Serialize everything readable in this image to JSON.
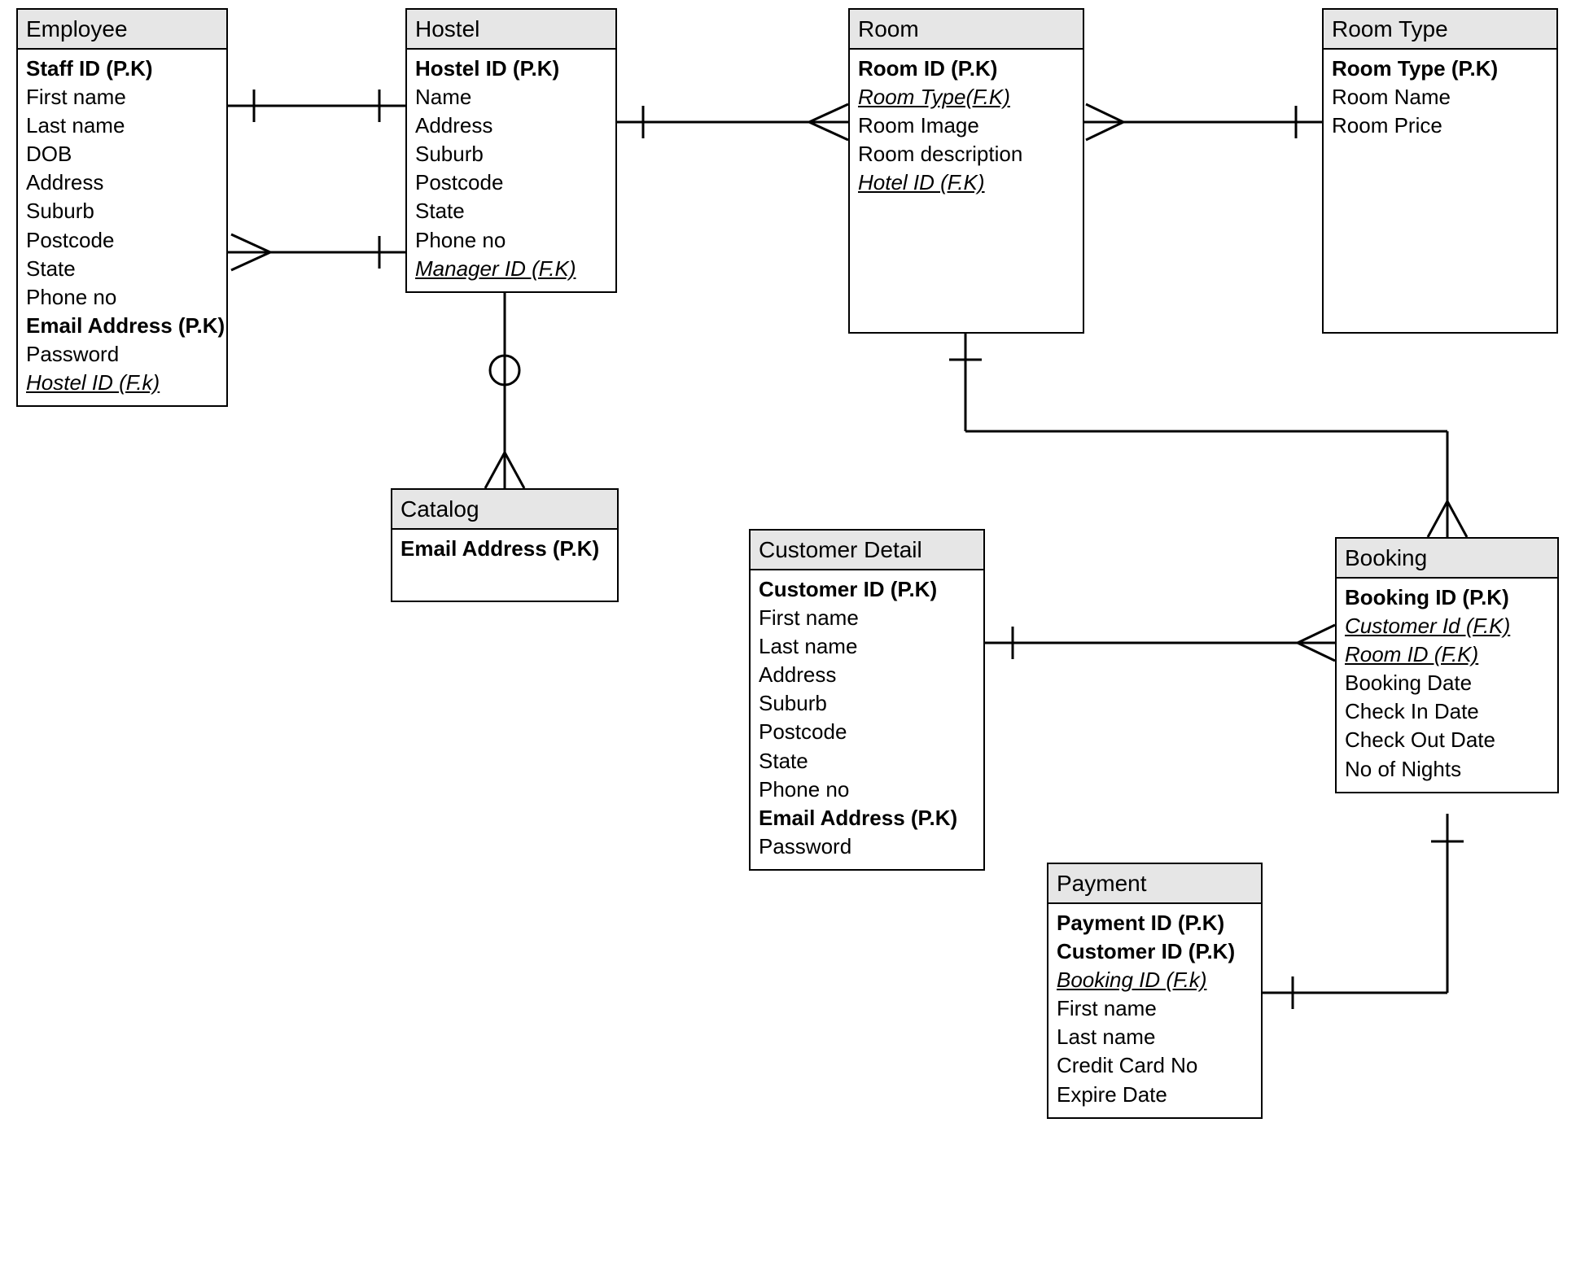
{
  "entities": {
    "employee": {
      "title": "Employee",
      "attrs": [
        {
          "text": "Staff ID (P.K)",
          "pk": true
        },
        {
          "text": "First name"
        },
        {
          "text": "Last name"
        },
        {
          "text": "DOB"
        },
        {
          "text": "Address"
        },
        {
          "text": "Suburb"
        },
        {
          "text": "Postcode"
        },
        {
          "text": "State"
        },
        {
          "text": "Phone no"
        },
        {
          "text": "Email Address (P.K)",
          "pk": true
        },
        {
          "text": "Password"
        },
        {
          "text": "Hostel ID (F.k)",
          "fk": true
        }
      ]
    },
    "hostel": {
      "title": "Hostel",
      "attrs": [
        {
          "text": "Hostel ID (P.K)",
          "pk": true
        },
        {
          "text": "Name"
        },
        {
          "text": "Address"
        },
        {
          "text": "Suburb"
        },
        {
          "text": "Postcode"
        },
        {
          "text": "State"
        },
        {
          "text": "Phone no"
        },
        {
          "text": "Manager ID (F.K)",
          "fk": true
        }
      ]
    },
    "room": {
      "title": "Room",
      "attrs": [
        {
          "text": "Room ID (P.K)",
          "pk": true
        },
        {
          "text": "Room Type(F.K)",
          "fk": true
        },
        {
          "text": "Room Image"
        },
        {
          "text": "Room description"
        },
        {
          "text": "Hotel  ID (F.K)",
          "fk": true
        }
      ]
    },
    "roomtype": {
      "title": "Room Type",
      "attrs": [
        {
          "text": "Room Type (P.K)",
          "pk": true
        },
        {
          "text": "Room Name"
        },
        {
          "text": "Room Price"
        }
      ]
    },
    "catalog": {
      "title": "Catalog",
      "attrs": [
        {
          "text": "Email Address (P.K)",
          "pk": true
        }
      ]
    },
    "customer": {
      "title": "Customer Detail",
      "attrs": [
        {
          "text": "Customer ID (P.K)",
          "pk": true
        },
        {
          "text": "First name"
        },
        {
          "text": "Last name"
        },
        {
          "text": "Address"
        },
        {
          "text": "Suburb"
        },
        {
          "text": "Postcode"
        },
        {
          "text": "State"
        },
        {
          "text": "Phone no"
        },
        {
          "text": "Email Address (P.K)",
          "pk": true
        },
        {
          "text": "Password"
        }
      ]
    },
    "booking": {
      "title": "Booking",
      "attrs": [
        {
          "text": "Booking ID (P.K)",
          "pk": true
        },
        {
          "text": "Customer Id (F.K)",
          "fk": true
        },
        {
          "text": "Room ID (F.K)",
          "fk": true
        },
        {
          "text": "Booking Date"
        },
        {
          "text": "Check In Date"
        },
        {
          "text": "Check Out Date"
        },
        {
          "text": "No of Nights"
        }
      ]
    },
    "payment": {
      "title": "Payment",
      "attrs": [
        {
          "text": "Payment ID (P.K)",
          "pk": true
        },
        {
          "text": "Customer ID (P.K)",
          "pk": true
        },
        {
          "text": "Booking ID (F.k)",
          "fk": true
        },
        {
          "text": "First name"
        },
        {
          "text": "Last name"
        },
        {
          "text": "Credit Card No"
        },
        {
          "text": "Expire Date"
        }
      ]
    }
  }
}
